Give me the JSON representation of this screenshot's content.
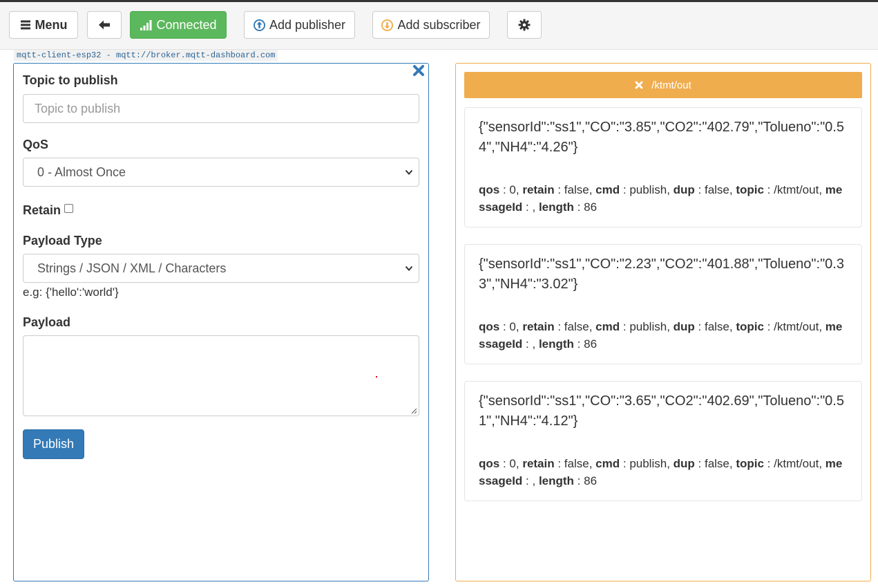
{
  "toolbar": {
    "menu_label": "Menu",
    "connected_label": "Connected",
    "add_publisher_label": "Add publisher",
    "add_subscriber_label": "Add subscriber",
    "colors": {
      "connected": "#5cb85c",
      "publisher_icon": "#337ab7",
      "subscriber_icon": "#f0ad4e"
    }
  },
  "client_label": "mqtt-client-esp32 - mqtt://broker.mqtt-dashboard.com",
  "publisher": {
    "topic_label": "Topic to publish",
    "topic_placeholder": "Topic to publish",
    "topic_value": "",
    "qos_label": "QoS",
    "qos_selected": "0 - Almost Once",
    "retain_label": "Retain",
    "retain_checked": false,
    "payload_type_label": "Payload Type",
    "payload_type_selected": "Strings / JSON / XML / Characters",
    "payload_hint": "e.g: {'hello':'world'}",
    "payload_label": "Payload",
    "payload_value": "",
    "publish_label": "Publish",
    "accent_color": "#337ab7"
  },
  "subscriber": {
    "topic": "/ktmt/out",
    "accent_color": "#f0ad4e",
    "meta_keys": {
      "qos": "qos",
      "retain": "retain",
      "cmd": "cmd",
      "dup": "dup",
      "topic": "topic",
      "messageId": "messageId",
      "length": "length"
    },
    "messages": [
      {
        "payload": "{\"sensorId\":\"ss1\",\"CO\":\"3.85\",\"CO2\":\"402.79\",\"Tolueno\":\"0.54\",\"NH4\":\"4.26\"}",
        "qos": "0",
        "retain": "false",
        "cmd": "publish",
        "dup": "false",
        "topic": "/ktmt/out",
        "messageId": "",
        "length": "86"
      },
      {
        "payload": "{\"sensorId\":\"ss1\",\"CO\":\"2.23\",\"CO2\":\"401.88\",\"Tolueno\":\"0.33\",\"NH4\":\"3.02\"}",
        "qos": "0",
        "retain": "false",
        "cmd": "publish",
        "dup": "false",
        "topic": "/ktmt/out",
        "messageId": "",
        "length": "86"
      },
      {
        "payload": "{\"sensorId\":\"ss1\",\"CO\":\"3.65\",\"CO2\":\"402.69\",\"Tolueno\":\"0.51\",\"NH4\":\"4.12\"}",
        "qos": "0",
        "retain": "false",
        "cmd": "publish",
        "dup": "false",
        "topic": "/ktmt/out",
        "messageId": "",
        "length": "86"
      }
    ]
  }
}
